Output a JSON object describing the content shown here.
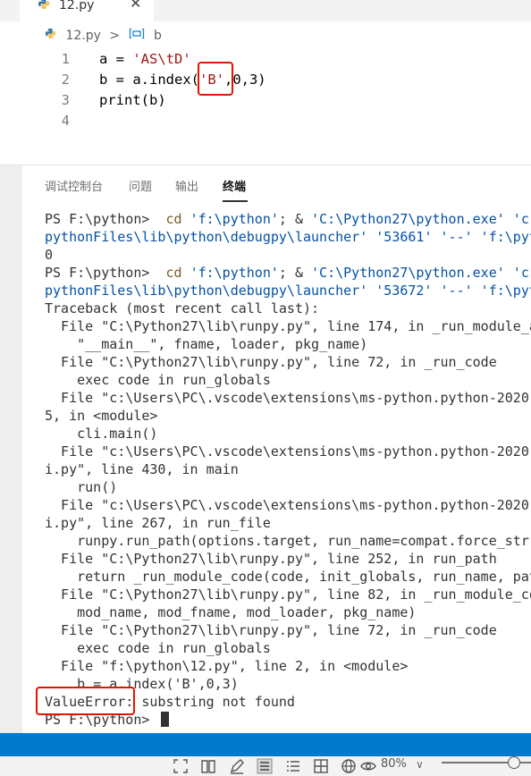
{
  "tab": {
    "filename": "12.py",
    "close": "✕"
  },
  "breadcrumb": {
    "file": "12.py",
    "separator": ">",
    "symbol": "b"
  },
  "editor": {
    "lines": [
      {
        "num": "1",
        "parts": [
          {
            "t": "a = ",
            "c": ""
          },
          {
            "t": "'AS\\tD'",
            "c": "str"
          }
        ]
      },
      {
        "num": "2",
        "parts": [
          {
            "t": "b = a.index(",
            "c": ""
          },
          {
            "t": "'B'",
            "c": "str"
          },
          {
            "t": ",0,3)",
            "c": ""
          }
        ]
      },
      {
        "num": "3",
        "parts": [
          {
            "t": "print(b)",
            "c": ""
          }
        ]
      },
      {
        "num": "4",
        "parts": []
      }
    ]
  },
  "panel": {
    "tabs": [
      "调试控制台",
      "问题",
      "输出",
      "终端"
    ],
    "active_tab": "终端"
  },
  "terminal": {
    "lines": [
      [
        {
          "t": "PS F:\\python> ",
          "c": ""
        },
        {
          "t": " cd ",
          "c": "yel"
        },
        {
          "t": "'f:\\python'",
          "c": "blue"
        },
        {
          "t": "; & ",
          "c": ""
        },
        {
          "t": "'C:\\Python27\\python.exe' 'c:",
          "c": "blue"
        }
      ],
      [
        {
          "t": "pythonFiles\\lib\\python\\debugpy\\launcher' '53661' '--' 'f:\\pyt",
          "c": "blue"
        }
      ],
      [
        {
          "t": "0",
          "c": ""
        }
      ],
      [
        {
          "t": "PS F:\\python> ",
          "c": ""
        },
        {
          "t": " cd ",
          "c": "yel"
        },
        {
          "t": "'f:\\python'",
          "c": "blue"
        },
        {
          "t": "; & ",
          "c": ""
        },
        {
          "t": "'C:\\Python27\\python.exe' 'c:",
          "c": "blue"
        }
      ],
      [
        {
          "t": "pythonFiles\\lib\\python\\debugpy\\launcher' '53672' '--' 'f:\\pyt",
          "c": "blue"
        }
      ],
      [
        {
          "t": "Traceback (most recent call last):",
          "c": ""
        }
      ],
      [
        {
          "t": "  File \"C:\\Python27\\lib\\runpy.py\", line 174, in _run_module_a",
          "c": ""
        }
      ],
      [
        {
          "t": "    \"__main__\", fname, loader, pkg_name)",
          "c": ""
        }
      ],
      [
        {
          "t": "  File \"C:\\Python27\\lib\\runpy.py\", line 72, in _run_code",
          "c": ""
        }
      ],
      [
        {
          "t": "    exec code in run_globals",
          "c": ""
        }
      ],
      [
        {
          "t": "  File \"c:\\Users\\PC\\.vscode\\extensions\\ms-python.python-2020.",
          "c": ""
        }
      ],
      [
        {
          "t": "5, in <module>",
          "c": ""
        }
      ],
      [
        {
          "t": "    cli.main()",
          "c": ""
        }
      ],
      [
        {
          "t": "  File \"c:\\Users\\PC\\.vscode\\extensions\\ms-python.python-2020.",
          "c": ""
        }
      ],
      [
        {
          "t": "i.py\", line 430, in main",
          "c": ""
        }
      ],
      [
        {
          "t": "    run()",
          "c": ""
        }
      ],
      [
        {
          "t": "  File \"c:\\Users\\PC\\.vscode\\extensions\\ms-python.python-2020.",
          "c": ""
        }
      ],
      [
        {
          "t": "i.py\", line 267, in run_file",
          "c": ""
        }
      ],
      [
        {
          "t": "    runpy.run_path(options.target, run_name=compat.force_str(",
          "c": ""
        }
      ],
      [
        {
          "t": "  File \"C:\\Python27\\lib\\runpy.py\", line 252, in run_path",
          "c": ""
        }
      ],
      [
        {
          "t": "    return _run_module_code(code, init_globals, run_name, pat",
          "c": ""
        }
      ],
      [
        {
          "t": "  File \"C:\\Python27\\lib\\runpy.py\", line 82, in _run_module_co",
          "c": ""
        }
      ],
      [
        {
          "t": "    mod_name, mod_fname, mod_loader, pkg_name)",
          "c": ""
        }
      ],
      [
        {
          "t": "  File \"C:\\Python27\\lib\\runpy.py\", line 72, in _run_code",
          "c": ""
        }
      ],
      [
        {
          "t": "    exec code in run_globals",
          "c": ""
        }
      ],
      [
        {
          "t": "  File \"f:\\python\\12.py\", line 2, in <module>",
          "c": ""
        }
      ],
      [
        {
          "t": "    b = a.index('B',0,3)",
          "c": ""
        }
      ],
      [
        {
          "t": "ValueError: substring not found",
          "c": ""
        }
      ],
      [
        {
          "t": "PS F:\\python> ",
          "c": ""
        }
      ]
    ]
  },
  "zoom": {
    "value": "80%",
    "chevron": "∨"
  },
  "colors": {
    "statusbar": "#007acc",
    "highlight_box": "#e51400",
    "string": "#a31515",
    "terminal_path": "#0451a5"
  },
  "icons": [
    "python-file-icon",
    "variable-symbol-icon",
    "fit-icon",
    "book-icon",
    "pen-icon",
    "document-icon",
    "list-icon",
    "grid-icon",
    "globe-icon",
    "eye-icon"
  ]
}
